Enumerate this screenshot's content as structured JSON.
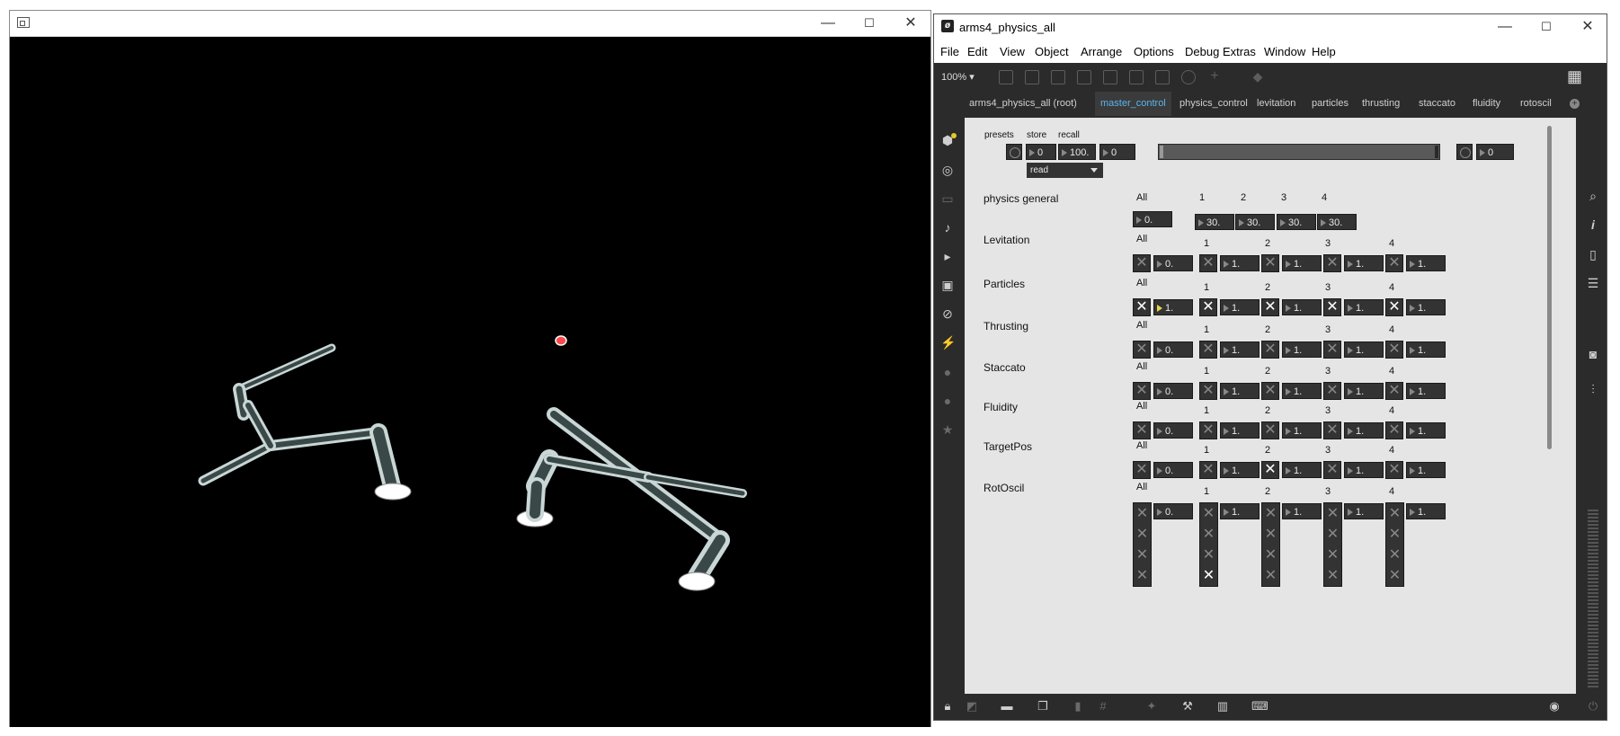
{
  "render_window": {
    "controls": {
      "minimize": "—",
      "maximize": "☐",
      "close": "✕"
    }
  },
  "patcher": {
    "window_title": "arms4_physics_all",
    "controls": {
      "minimize": "—",
      "maximize": "☐",
      "close": "✕"
    },
    "menu": [
      "File",
      "Edit",
      "View",
      "Object",
      "Arrange",
      "Options",
      "Debug",
      "Extras",
      "Window",
      "Help"
    ],
    "zoom": "100% ▾",
    "tabs": [
      "arms4_physics_all (root)",
      "master_control",
      "physics_control",
      "levitation",
      "particles",
      "thrusting",
      "staccato",
      "fluidity",
      "rotoscil"
    ],
    "active_tab": "master_control",
    "presets": {
      "presets_label": "presets",
      "store_label": "store",
      "recall_label": "recall",
      "store_value": "0",
      "recall_value": "100.",
      "num_a": "0",
      "num_b": "0",
      "menu_value": "read"
    },
    "col_all": "All",
    "col_1": "1",
    "col_2": "2",
    "col_3": "3",
    "col_4": "4",
    "physics_general": {
      "label": "physics general",
      "all_value": "0.",
      "values": [
        "30.",
        "30.",
        "30.",
        "30."
      ]
    },
    "sections": [
      {
        "label": "Levitation",
        "all_value": "0.",
        "values": [
          "1.",
          "1.",
          "1.",
          "1."
        ]
      },
      {
        "label": "Particles",
        "all_value": "1.",
        "values": [
          "1.",
          "1.",
          "1.",
          "1."
        ]
      },
      {
        "label": "Thrusting",
        "all_value": "0.",
        "values": [
          "1.",
          "1.",
          "1.",
          "1."
        ]
      },
      {
        "label": "Staccato",
        "all_value": "0.",
        "values": [
          "1.",
          "1.",
          "1.",
          "1."
        ]
      },
      {
        "label": "Fluidity",
        "all_value": "0.",
        "values": [
          "1.",
          "1.",
          "1.",
          "1."
        ]
      },
      {
        "label": "TargetPos",
        "all_value": "0.",
        "values": [
          "1.",
          "1.",
          "1.",
          "1."
        ]
      },
      {
        "label": "RotOscil",
        "all_value": "0.",
        "values": [
          "1.",
          "1.",
          "1.",
          "1."
        ]
      }
    ],
    "toggle_glyph": "✕"
  }
}
